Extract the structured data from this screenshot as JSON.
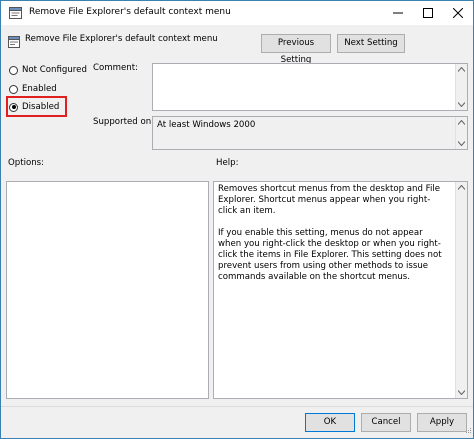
{
  "window": {
    "title": "Remove File Explorer's default context menu"
  },
  "header": {
    "title": "Remove File Explorer's default context menu",
    "previous_label": "Previous Setting",
    "next_label": "Next Setting"
  },
  "state_options": [
    {
      "label": "Not Configured",
      "checked": false
    },
    {
      "label": "Enabled",
      "checked": false
    },
    {
      "label": "Disabled",
      "checked": true
    }
  ],
  "comment": {
    "label": "Comment:",
    "value": ""
  },
  "supported": {
    "label": "Supported on:",
    "value": "At least Windows 2000"
  },
  "options": {
    "label": "Options:"
  },
  "help": {
    "label": "Help:",
    "paragraph1": "Removes shortcut menus from the desktop and File Explorer. Shortcut menus appear when you right-click an item.",
    "paragraph2": "If you enable this setting, menus do not appear when you right-click the desktop or when you right-click the items in File Explorer. This setting does not prevent users from using other methods to issue commands available on the shortcut menus."
  },
  "footer": {
    "ok_label": "OK",
    "cancel_label": "Cancel",
    "apply_label": "Apply"
  },
  "colors": {
    "highlight_border": "#e02020",
    "close_button_hover": "#e81123",
    "window_border": "#3c7fb1"
  }
}
